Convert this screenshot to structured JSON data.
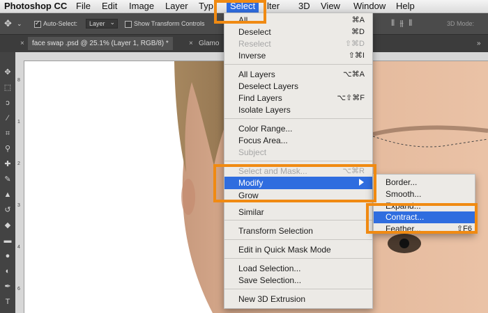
{
  "menubar": {
    "app": "Photoshop CC",
    "items": [
      "File",
      "Edit",
      "Image",
      "Layer",
      "Typ",
      "Select",
      "lter",
      "3D",
      "View",
      "Window",
      "Help"
    ]
  },
  "options": {
    "auto_select_label": "Auto-Select:",
    "auto_select_value": "Layer",
    "transform_label": "Show Transform Controls",
    "mode_label": "3D Mode:"
  },
  "tabs": [
    "face swap .psd @ 25.1% (Layer 1, RGB/8) *",
    "Glamo"
  ],
  "ruler": {
    "left_numbers": [
      "8",
      "1",
      "2",
      "3",
      "4",
      "6"
    ]
  },
  "select_menu": {
    "items": [
      {
        "label": "All",
        "shortcut": "⌘A",
        "disabled": false
      },
      {
        "label": "Deselect",
        "shortcut": "⌘D",
        "disabled": false
      },
      {
        "label": "Reselect",
        "shortcut": "⇧⌘D",
        "disabled": true
      },
      {
        "label": "Inverse",
        "shortcut": "⇧⌘I",
        "disabled": false
      },
      {
        "label": "All Layers",
        "shortcut": "⌥⌘A",
        "disabled": false
      },
      {
        "label": "Deselect Layers",
        "shortcut": "",
        "disabled": false
      },
      {
        "label": "Find Layers",
        "shortcut": "⌥⇧⌘F",
        "disabled": false
      },
      {
        "label": "Isolate Layers",
        "shortcut": "",
        "disabled": false
      },
      {
        "label": "Color Range...",
        "shortcut": "",
        "disabled": false
      },
      {
        "label": "Focus Area...",
        "shortcut": "",
        "disabled": false
      },
      {
        "label": "Subject",
        "shortcut": "",
        "disabled": true
      },
      {
        "label": "Select and Mask...",
        "shortcut": "⌥⌘R",
        "disabled": true
      },
      {
        "label": "Modify",
        "shortcut": "",
        "disabled": false,
        "highlighted": true
      },
      {
        "label": "Grow",
        "shortcut": "",
        "disabled": false
      },
      {
        "label": "Similar",
        "shortcut": "",
        "disabled": false
      },
      {
        "label": "Transform Selection",
        "shortcut": "",
        "disabled": false
      },
      {
        "label": "Edit in Quick Mask Mode",
        "shortcut": "",
        "disabled": false
      },
      {
        "label": "Load Selection...",
        "shortcut": "",
        "disabled": false
      },
      {
        "label": "Save Selection...",
        "shortcut": "",
        "disabled": false
      },
      {
        "label": "New 3D Extrusion",
        "shortcut": "",
        "disabled": false
      }
    ]
  },
  "modify_menu": {
    "items": [
      {
        "label": "Border...",
        "shortcut": ""
      },
      {
        "label": "Smooth...",
        "shortcut": ""
      },
      {
        "label": "Expand...",
        "shortcut": ""
      },
      {
        "label": "Contract...",
        "shortcut": "",
        "highlighted": true
      },
      {
        "label": "Feather...",
        "shortcut": "⇧F6"
      }
    ]
  },
  "colors": {
    "accent": "#2f6ddf",
    "highlight_box": "#f08a12",
    "skin": "#e3b497"
  }
}
